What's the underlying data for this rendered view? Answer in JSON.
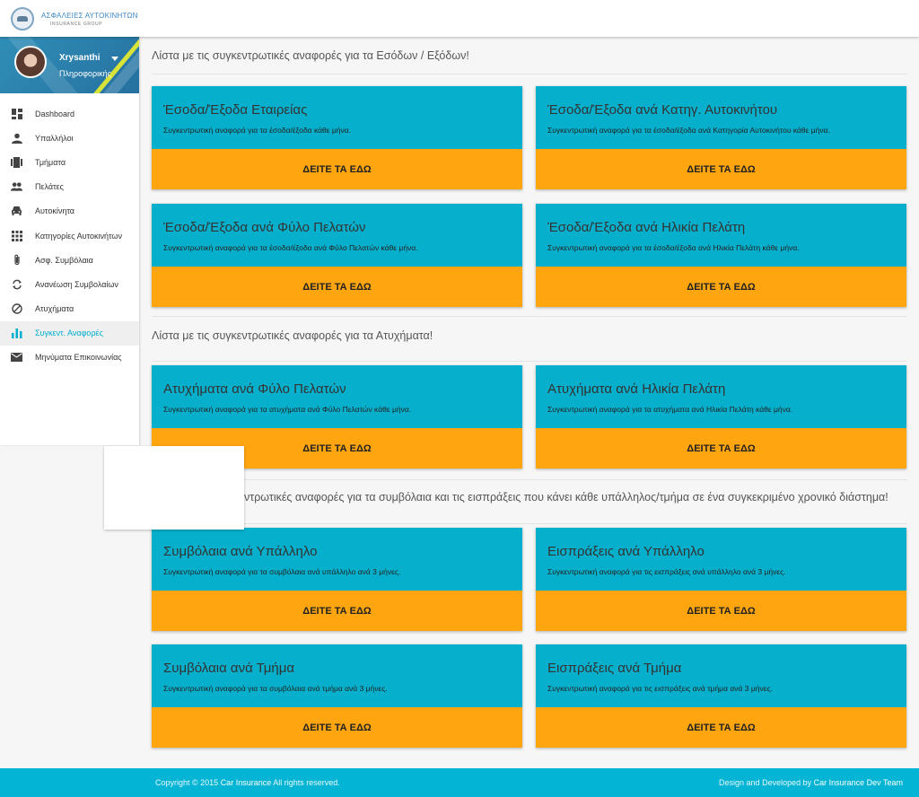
{
  "brand": {
    "title": "ΑΣΦΑΛΕΙΕΣ ΑΥΤΟΚΙΝΗΤΩΝ",
    "subtitle": "INSURANCE GROUP"
  },
  "profile": {
    "name": "Xrysanthi",
    "role": "Πληροφορικής"
  },
  "menu": {
    "items": [
      {
        "label": "Dashboard",
        "icon": "dashboard-icon"
      },
      {
        "label": "Υπαλλήλοι",
        "icon": "person-icon"
      },
      {
        "label": "Τμήματα",
        "icon": "departments-icon"
      },
      {
        "label": "Πελάτες",
        "icon": "people-icon"
      },
      {
        "label": "Αυτοκίνητα",
        "icon": "car-icon"
      },
      {
        "label": "Κατηγορίες Αυτοκινήτων",
        "icon": "grid-icon"
      },
      {
        "label": "Ασφ. Συμβόλαια",
        "icon": "paperclip-icon"
      },
      {
        "label": "Ανανέωση Συμβολαίων",
        "icon": "refresh-icon"
      },
      {
        "label": "Ατυχήματα",
        "icon": "block-icon"
      },
      {
        "label": "Συγκεντ. Αναφορές",
        "icon": "bar-chart-icon"
      },
      {
        "label": "Μηνύματα Επικοινωνίας",
        "icon": "mail-icon"
      }
    ],
    "active_index": 9
  },
  "sections": [
    {
      "title": "Λίστα με τις συγκεντρωτικές αναφορές για τα Εσόδων / Εξόδων!"
    },
    {
      "title": "Λίστα με τις συγκεντρωτικές αναφορές για τα Ατυχήματα!"
    },
    {
      "title": "ντρωτικές αναφορές για τα συμβόλαια και τις εισπράξεις που κάνει κάθε υπάλληλος/τμήμα σε ένα συγκεκριμένο χρονικό διάστημα!"
    }
  ],
  "cards": [
    {
      "title": "Έσοδα/Έξοδα Εταιρείας",
      "desc": "Συγκεντρωτική αναφορά για τα έσοδα/έξοδα κάθε μήνα.",
      "button": "ΔΕΙΤΕ ΤΑ ΕΔΩ"
    },
    {
      "title": "Έσοδα/Έξοδα ανά Κατηγ. Αυτοκινήτου",
      "desc": "Συγκεντρωτική αναφορά για τα έσοδα/έξοδα ανά Κατηγορία Αυτοκινήτου κάθε μήνα.",
      "button": "ΔΕΙΤΕ ΤΑ ΕΔΩ"
    },
    {
      "title": "Έσοδα/Έξοδα ανά Φύλο Πελατών",
      "desc": "Συγκεντρωτική αναφορά για τα έσοδα/έξοδα ανά Φύλο Πελατών κάθε μήνα.",
      "button": "ΔΕΙΤΕ ΤΑ ΕΔΩ"
    },
    {
      "title": "Έσοδα/Έξοδα ανά Ηλικία Πελάτη",
      "desc": "Συγκεντρωτική αναφορά για τα έσοδα/έξοδα ανά Ηλικία Πελάτη κάθε μήνα.",
      "button": "ΔΕΙΤΕ ΤΑ ΕΔΩ"
    },
    {
      "title": "Ατυχήματα ανά Φύλο Πελατών",
      "desc": "Συγκεντρωτική αναφορά για τα ατυχήματα ανά Φύλο Πελατών κάθε μήνα.",
      "button": "ΔΕΙΤΕ ΤΑ ΕΔΩ"
    },
    {
      "title": "Ατυχήματα ανά Ηλικία Πελάτη",
      "desc": "Συγκεντρωτική αναφορά για τα ατυχήματα ανά Ηλικία Πελάτη κάθε μήνα.",
      "button": "ΔΕΙΤΕ ΤΑ ΕΔΩ"
    },
    {
      "title": "Συμβόλαια ανά Υπάλληλο",
      "desc": "Συγκεντρωτική αναφορά για τα συμβόλαια ανά υπάλληλο ανά 3 μήνες.",
      "button": "ΔΕΙΤΕ ΤΑ ΕΔΩ"
    },
    {
      "title": "Εισπράξεις ανά Υπάλληλο",
      "desc": "Συγκεντρωτική αναφορά για τις εισπράξεις ανά υπάλληλο ανά 3 μήνες.",
      "button": "ΔΕΙΤΕ ΤΑ ΕΔΩ"
    },
    {
      "title": "Συμβόλαια ανά Τμήμα",
      "desc": "Συγκεντρωτική αναφορά για τα συμβόλαια ανά τμήμα ανά 3 μήνες.",
      "button": "ΔΕΙΤΕ ΤΑ ΕΔΩ"
    },
    {
      "title": "Εισπράξεις ανά Τμήμα",
      "desc": "Συγκεντρωτική αναφορά για τις εισπράξεις ανά τμήμα ανά 3 μήνες.",
      "button": "ΔΕΙΤΕ ΤΑ ΕΔΩ"
    }
  ],
  "footer": {
    "copyright_prefix": "Copyright © 2015 ",
    "copyright_link": "Car Insurance",
    "copyright_suffix": " All rights reserved.",
    "credit_prefix": "Design and Developed by ",
    "credit_link": "Car Insurance Dev Team"
  },
  "colors": {
    "card_top": "#06b0cc",
    "card_button": "#ffa50f",
    "footer": "#04b4d4",
    "active": "#00afd0"
  }
}
